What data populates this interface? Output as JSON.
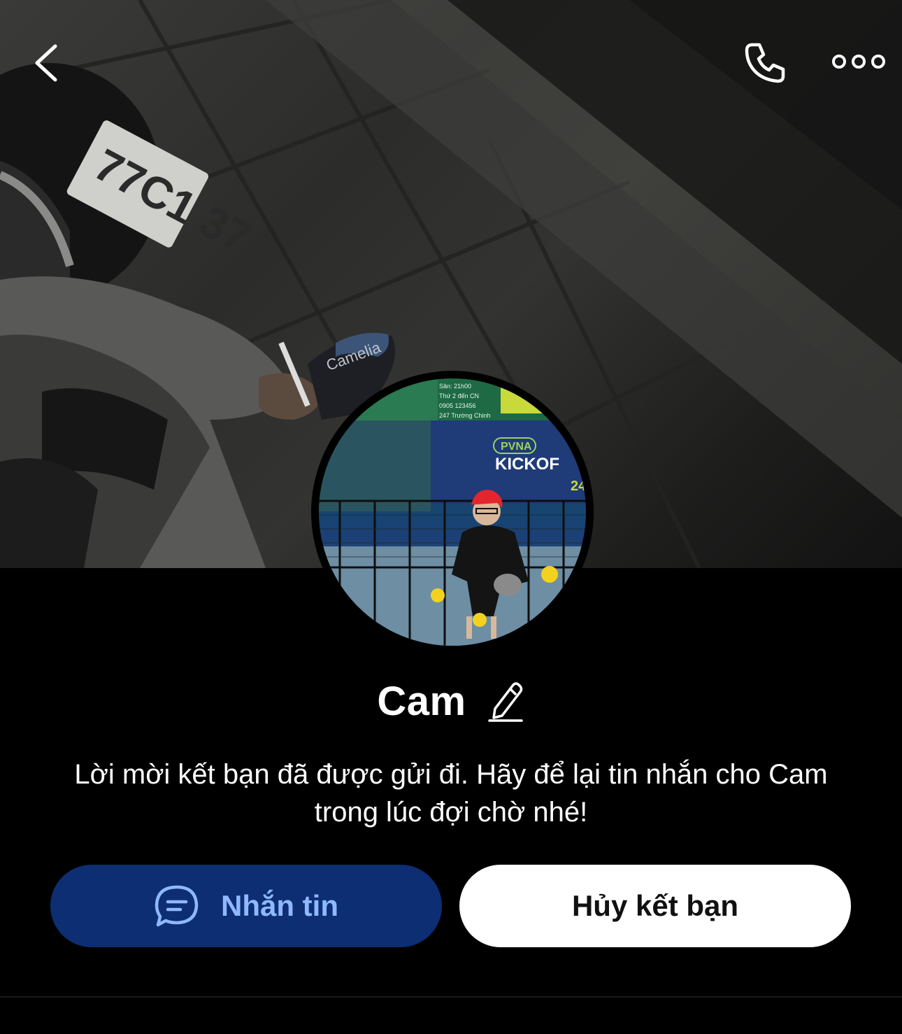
{
  "header": {
    "back_icon": "chevron-left-icon",
    "call_icon": "phone-icon",
    "more_icon": "ellipsis-circles-icon"
  },
  "cover": {
    "plate_text": "77C1 37",
    "slipper_brand": "Camelia",
    "description_icon": "cover-photo"
  },
  "avatar": {
    "board_lines": [
      "Sân: 21h00",
      "Thứ 2 đến CN",
      "0905 123456",
      "247 Trường Chinh"
    ],
    "sign_pvna": "PVNA",
    "sign_kickoff": "KICKOF",
    "sign_number": "24"
  },
  "profile": {
    "name": "Cam",
    "edit_icon": "pencil-icon"
  },
  "status_message": "Lời mời kết bạn đã được gửi đi. Hãy để lại tin nhắn cho Cam trong lúc đợi chờ nhé!",
  "actions": {
    "message_label": "Nhắn tin",
    "message_icon": "chat-bubble-icon",
    "unfriend_label": "Hủy kết bạn"
  },
  "colors": {
    "background": "#000000",
    "message_button_bg": "#0d2e72",
    "message_button_text": "#8fb8ff",
    "unfriend_button_bg": "#ffffff",
    "unfriend_button_text": "#111111"
  }
}
